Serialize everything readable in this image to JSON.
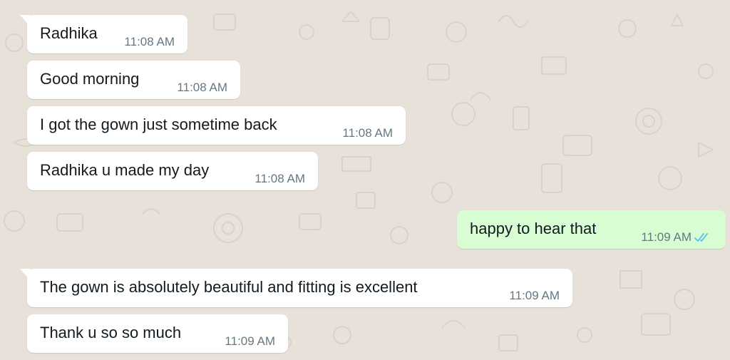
{
  "messages": [
    {
      "direction": "incoming",
      "text": "Radhika",
      "time": "11:08 AM",
      "tail": true
    },
    {
      "direction": "incoming",
      "text": "Good morning",
      "time": "11:08 AM",
      "tail": false
    },
    {
      "direction": "incoming",
      "text": "I got the gown just sometime back",
      "time": "11:08 AM",
      "tail": false
    },
    {
      "direction": "incoming",
      "text": "Radhika u made my day",
      "time": "11:08 AM",
      "tail": false
    },
    {
      "direction": "outgoing",
      "text": "happy to hear that",
      "time": "11:09 AM",
      "status": "read",
      "status_icon": "double-check-icon",
      "tail": false
    },
    {
      "direction": "incoming",
      "text": "The gown is absolutely beautiful and fitting is excellent",
      "time": "11:09 AM",
      "tail": true
    },
    {
      "direction": "incoming",
      "text": "Thank u so so much",
      "time": "11:09 AM",
      "tail": false
    }
  ],
  "colors": {
    "chat_background": "#e7e1d9",
    "incoming_bubble": "#ffffff",
    "outgoing_bubble": "#d9fdd3",
    "text": "#111b21",
    "timestamp": "#667781",
    "read_ticks": "#53bdeb"
  }
}
